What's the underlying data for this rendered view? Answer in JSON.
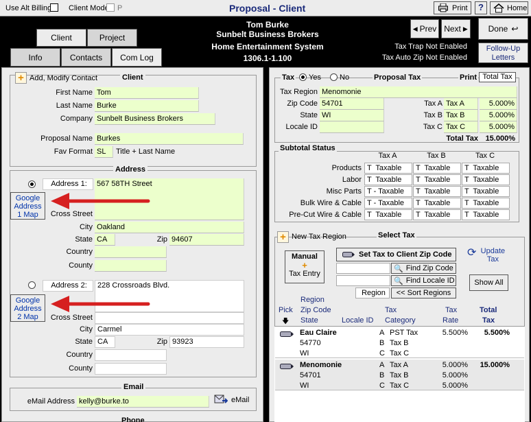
{
  "topbar": {
    "use_alt_billing": "Use Alt Billing",
    "client_mode": "Client Mode",
    "p_label": "P",
    "title": "Proposal - Client",
    "print": "Print",
    "help": "?",
    "home": "Home"
  },
  "header": {
    "name": "Tom Burke",
    "company": "Sunbelt Business Brokers",
    "project": "Home Entertainment System",
    "number": "1306.1-1.100",
    "tax_trap": "Tax Trap Not Enabled",
    "tax_auto_zip": "Tax Auto Zip Not Enabled",
    "prev": "Prev",
    "next": "Next",
    "done": "Done",
    "follow_up": "Follow-Up Letters"
  },
  "tabs": {
    "client": "Client",
    "project": "Project",
    "info": "Info",
    "contacts": "Contacts",
    "com_log": "Com Log"
  },
  "client": {
    "add_modify": "Add, Modify Contact",
    "section": "Client",
    "first_name_label": "First Name",
    "first_name": "Tom",
    "last_name_label": "Last Name",
    "last_name": "Burke",
    "company_label": "Company",
    "company": "Sunbelt Business Brokers",
    "proposal_name_label": "Proposal Name",
    "proposal_name": "Burkes",
    "fav_format_label": "Fav Format",
    "fav_format_code": "SL",
    "fav_format": "Title + Last Name"
  },
  "address": {
    "section": "Address",
    "google1": "Google Address 1 Map",
    "google2": "Google Address 2 Map",
    "addr1_label": "Address 1:",
    "addr1": "567 58TH Street",
    "addr2_label": "Address 2:",
    "addr2": "228 Crossroads Blvd.",
    "cross_street": "Cross Street",
    "city_label": "City",
    "state_label": "State",
    "zip_label": "Zip",
    "country_label": "Country",
    "county_label": "County",
    "city1": "Oakland",
    "state1": "CA",
    "zip1": "94607",
    "city2": "Carmel",
    "state2": "CA",
    "zip2": "93923"
  },
  "email": {
    "section": "Email",
    "label": "eMail Address",
    "value": "kelly@burke.to",
    "button": "eMail",
    "phone_partial": "Phone"
  },
  "tax": {
    "tax_label": "Tax",
    "yes": "Yes",
    "no": "No",
    "proposal_tax": "Proposal Tax",
    "print_label": "Print",
    "total_tax_btn": "Total Tax",
    "region_label": "Tax Region",
    "region": "Menomonie",
    "zip_label": "Zip Code",
    "zip": "54701",
    "state_label": "State",
    "state": "WI",
    "locale_label": "Locale ID",
    "rates": [
      {
        "label": "Tax A",
        "name": "Tax A",
        "rate": "5.000%"
      },
      {
        "label": "Tax B",
        "name": "Tax B",
        "rate": "5.000%"
      },
      {
        "label": "Tax C",
        "name": "Tax C",
        "rate": "5.000%"
      }
    ],
    "total_label": "Total Tax",
    "total": "15.000%"
  },
  "subtotal": {
    "section": "Subtotal Status",
    "cols": [
      "Tax A",
      "Tax B",
      "Tax C"
    ],
    "rows": [
      {
        "label": "Products",
        "a": "T  Taxable",
        "b": "T  Taxable",
        "c": "T  Taxable"
      },
      {
        "label": "Labor",
        "a": "T  Taxable",
        "b": "T  Taxable",
        "c": "T  Taxable"
      },
      {
        "label": "Misc Parts",
        "a": "T - Taxable",
        "b": "T  Taxable",
        "c": "T  Taxable"
      },
      {
        "label": "Bulk Wire & Cable",
        "a": "T - Taxable",
        "b": "T  Taxable",
        "c": "T  Taxable"
      },
      {
        "label": "Pre-Cut Wire & Cable",
        "a": "T  Taxable",
        "b": "T  Taxable",
        "c": "T  Taxable"
      }
    ]
  },
  "select_tax": {
    "new_region": "New Tax Region",
    "section": "Select Tax",
    "manual": "Manual",
    "tax_entry": "Tax Entry",
    "set_zip": "Set Tax to Client Zip Code",
    "find_zip": "Find Zip Code",
    "find_locale": "Find Locale ID",
    "region_btn": "Region",
    "sort_regions": "<< Sort Regions",
    "update": "Update Tax",
    "show_all": "Show All",
    "h_pick": "Pick",
    "h_region": "Region",
    "h_zip": "Zip Code",
    "h_state": "State",
    "h_locale": "Locale ID",
    "h_tax": "Tax",
    "h_category": "Category",
    "h_tax2": "Tax",
    "h_rate": "Rate",
    "h_total": "Total",
    "h_total2": "Tax",
    "regions": [
      {
        "name": "Eau Claire",
        "zip": "54770",
        "state": "WI",
        "total": "5.500%",
        "taxes": [
          {
            "k": "A",
            "cat": "PST Tax",
            "rate": "5.500%"
          },
          {
            "k": "B",
            "cat": "Tax B",
            "rate": ""
          },
          {
            "k": "C",
            "cat": "Tax C",
            "rate": ""
          }
        ]
      },
      {
        "name": "Menomonie",
        "zip": "54701",
        "state": "WI",
        "total": "15.000%",
        "taxes": [
          {
            "k": "A",
            "cat": "Tax A",
            "rate": "5.000%"
          },
          {
            "k": "B",
            "cat": "Tax B",
            "rate": "5.000%"
          },
          {
            "k": "C",
            "cat": "Tax C",
            "rate": "5.000%"
          }
        ]
      }
    ]
  }
}
